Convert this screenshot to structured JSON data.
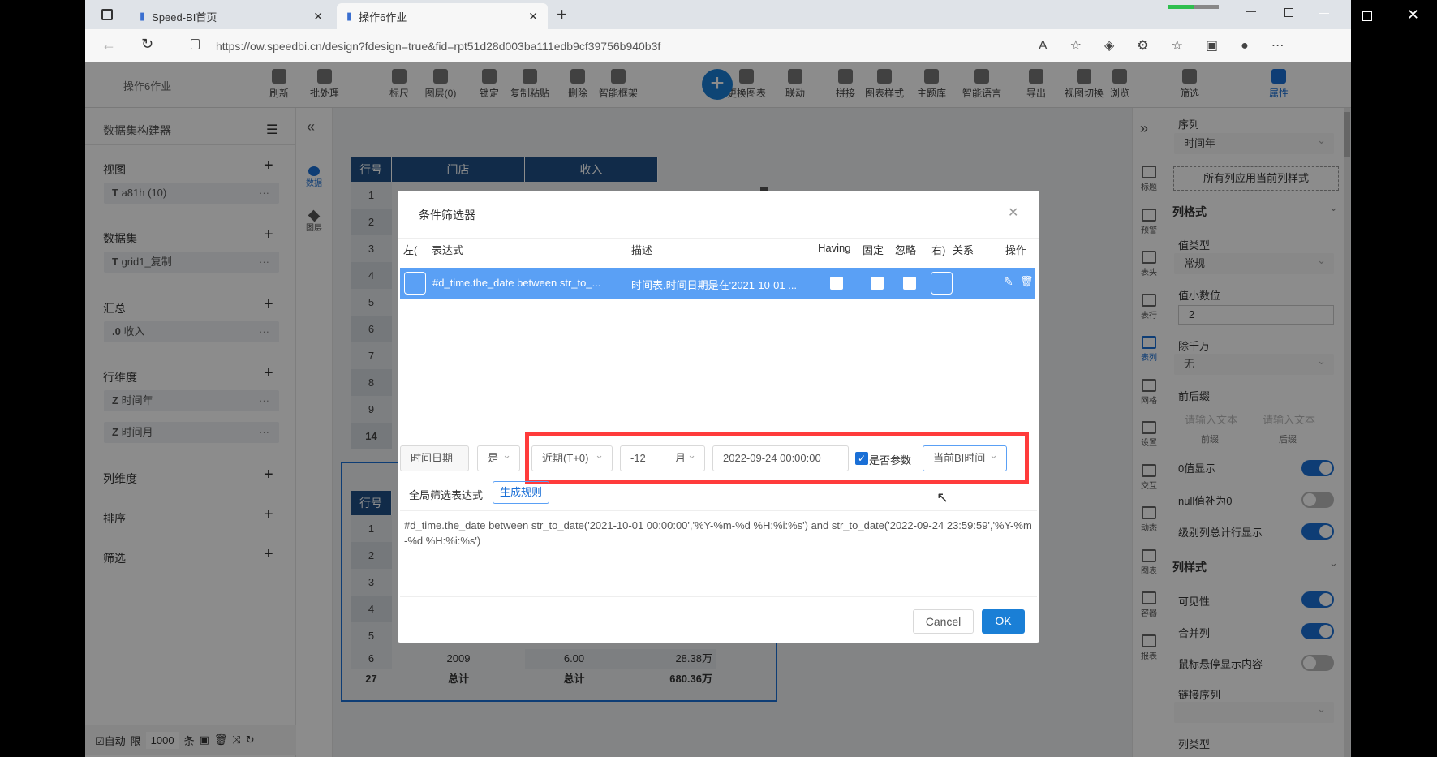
{
  "browser": {
    "tabs": [
      {
        "title": "Speed-BI首页"
      },
      {
        "title": "操作6作业"
      }
    ],
    "url": "https://ow.speedbi.cn/design?fdesign=true&fid=rpt51d28d003ba111edb9cf39756b940b3f"
  },
  "app": {
    "report_name": "操作6作业",
    "toolbar": [
      "刷新",
      "批处理",
      "标尺",
      "图层(0)",
      "锁定",
      "复制粘贴",
      "删除",
      "智能框架",
      "更换图表",
      "联动",
      "拼接",
      "图表样式",
      "主题库",
      "智能语言",
      "导出",
      "视图切换",
      "浏览",
      "筛选",
      "属性"
    ]
  },
  "left_panel": {
    "title": "数据集构建器",
    "sections": {
      "view": "视图",
      "dataset": "数据集",
      "summary": "汇总",
      "row_dim": "行维度",
      "col_dim": "列维度",
      "sort": "排序",
      "filter": "筛选"
    },
    "items": {
      "view": "a81h (10)",
      "dataset": "grid1_复制",
      "summary": "收入",
      "row1": "时间年",
      "row2": "时间月"
    },
    "item_prefix": {
      "text": "T",
      "number": ".0",
      "dim": "Z"
    },
    "more": "···",
    "footer": {
      "auto": "☑自动",
      "limit": "限",
      "limit_value": "1000",
      "unit": "条"
    }
  },
  "icon_strip": [
    {
      "label": "数据"
    },
    {
      "label": "图层"
    }
  ],
  "table1": {
    "headers": [
      "行号",
      "门店",
      "收入"
    ],
    "rows": [
      "1",
      "2",
      "3",
      "4",
      "5",
      "6",
      "7",
      "8",
      "9",
      "14"
    ]
  },
  "table2": {
    "headers": [
      "行号"
    ],
    "rows": [
      "1",
      "2",
      "3",
      "4",
      "5"
    ],
    "last_row": [
      "6",
      "2009",
      "6.00",
      "28.38万"
    ],
    "total": [
      "27",
      "总计",
      "总计",
      "680.36万"
    ]
  },
  "right_strip": [
    "标题",
    "预警",
    "表头",
    "表行",
    "表列",
    "网格",
    "设置",
    "交互",
    "动态",
    "图表",
    "容器",
    "报表"
  ],
  "properties": {
    "series_label": "序列",
    "series_value": "时间年",
    "apply_all": "所有列应用当前列样式",
    "col_format": "列格式",
    "value_type_label": "值类型",
    "value_type": "常规",
    "decimals_label": "值小数位",
    "decimals": "2",
    "divide_label": "除千万",
    "divide": "无",
    "affix_label": "前后缀",
    "prefix_ph": "请输入文本",
    "suffix_ph": "请输入文本",
    "prefix": "前缀",
    "suffix": "后缀",
    "zero_show": "0值显示",
    "null_zero": "null值补为0",
    "level_total": "级别列总计行显示",
    "col_style": "列样式",
    "visible": "可见性",
    "merge": "合并列",
    "hover": "鼠标悬停显示内容",
    "link_series": "链接序列",
    "col_type": "列类型",
    "toggles": {
      "zero_show": true,
      "null_zero": false,
      "level_total": true,
      "visible": true,
      "merge": true,
      "hover": false
    }
  },
  "modal": {
    "title": "条件筛选器",
    "columns": [
      "左(",
      "表达式",
      "描述",
      "Having",
      "固定",
      "忽略",
      "右)",
      "关系",
      "操作"
    ],
    "row": {
      "expr": "#d_time.the_date between str_to_...",
      "desc": "时间表.时间日期是在'2021-10-01 ..."
    },
    "field": "时间日期",
    "is": "是",
    "period": "近期(T+0)",
    "offset": "-12",
    "unit": "月",
    "date": "2022-09-24 00:00:00",
    "is_param_label": "是否参数",
    "is_param": true,
    "base_time": "当前BI时间",
    "global_label": "全局筛选表达式",
    "gen_rule": "生成规则",
    "expression": "#d_time.the_date between str_to_date('2021-10-01 00:00:00','%Y-%m-%d %H:%i:%s') and str_to_date('2022-09-24 23:59:59','%Y-%m-%d %H:%i:%s')",
    "cancel": "Cancel",
    "ok": "OK"
  },
  "colors": {
    "primary": "#1a6fd6",
    "header": "#1f4f86",
    "highlight": "#ff3b3b",
    "selected_row": "#5aa0f5"
  }
}
